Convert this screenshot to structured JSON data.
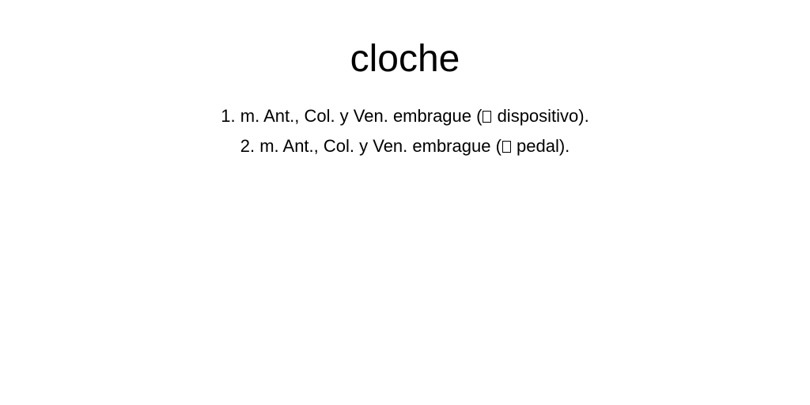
{
  "entry": {
    "headword": "cloche",
    "definitions": [
      {
        "number": "1.",
        "text_before": "m. Ant., Col. y Ven. embrague (",
        "icon": "missing-glyph-box",
        "text_after": " dispositivo)."
      },
      {
        "number": "2.",
        "text_before": "m. Ant., Col. y Ven. embrague (",
        "icon": "missing-glyph-box",
        "text_after": " pedal)."
      }
    ]
  }
}
